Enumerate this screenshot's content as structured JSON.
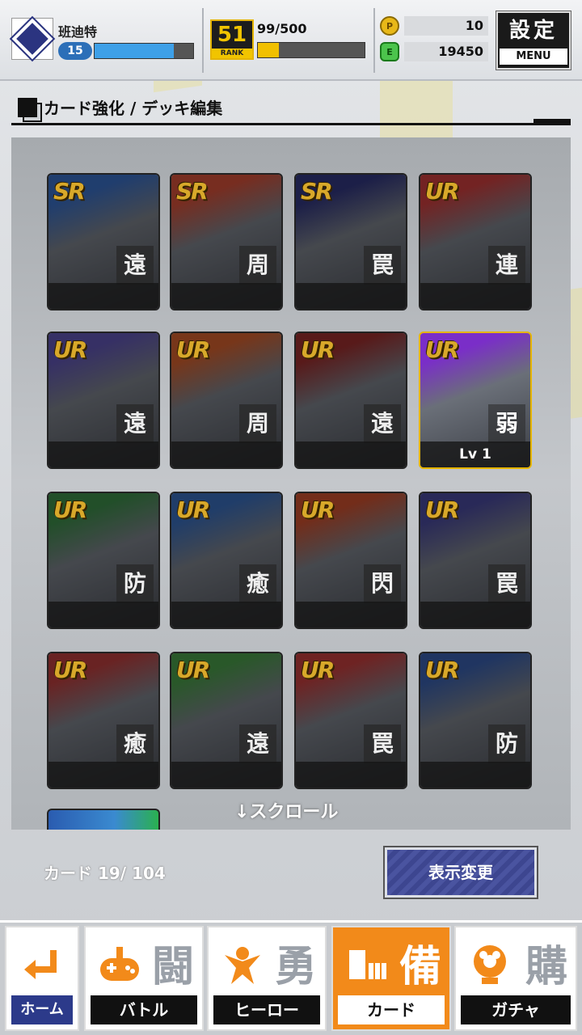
{
  "header": {
    "player_name": "班迪特",
    "level": "15",
    "level_progress": 0.8,
    "rank_number": "51",
    "rank_label": "RANK",
    "rank_exp": "99/500",
    "rank_progress": 0.2,
    "coin1_icon": "P",
    "coin1_value": "10",
    "coin2_icon": "E",
    "coin2_value": "19450",
    "menu_kanji": "設定",
    "menu_label": "MENU"
  },
  "section": {
    "title": "カード強化 / デッキ編集"
  },
  "cards": [
    {
      "rarity": "SR",
      "type": "遠",
      "bottom": "",
      "color": "#2a5db0"
    },
    {
      "rarity": "SR",
      "type": "周",
      "bottom": "",
      "color": "#c0402a"
    },
    {
      "rarity": "SR",
      "type": "罠",
      "bottom": "",
      "color": "#23286e"
    },
    {
      "rarity": "UR",
      "type": "連",
      "bottom": "",
      "color": "#b83030"
    },
    {
      "rarity": "UR",
      "type": "遠",
      "bottom": "",
      "color": "#5046a0"
    },
    {
      "rarity": "UR",
      "type": "周",
      "bottom": "",
      "color": "#c05020"
    },
    {
      "rarity": "UR",
      "type": "遠",
      "bottom": "",
      "color": "#8a2020"
    },
    {
      "rarity": "UR",
      "type": "弱",
      "bottom": "Lv 1",
      "color": "#7a2ec8",
      "selected": true
    },
    {
      "rarity": "UR",
      "type": "防",
      "bottom": "",
      "color": "#2d7a3a"
    },
    {
      "rarity": "UR",
      "type": "癒",
      "bottom": "",
      "color": "#2a5ca8"
    },
    {
      "rarity": "UR",
      "type": "閃",
      "bottom": "",
      "color": "#b84020"
    },
    {
      "rarity": "UR",
      "type": "罠",
      "bottom": "",
      "color": "#3a3a8a"
    },
    {
      "rarity": "UR",
      "type": "癒",
      "bottom": "",
      "color": "#a83030"
    },
    {
      "rarity": "UR",
      "type": "遠",
      "bottom": "",
      "color": "#3a8a3a"
    },
    {
      "rarity": "UR",
      "type": "罠",
      "bottom": "",
      "color": "#b03030"
    },
    {
      "rarity": "UR",
      "type": "防",
      "bottom": "",
      "color": "#2a4f9a"
    }
  ],
  "scroll_hint": "↓スクロール",
  "card_count": "カード 19/ 104",
  "display_change_button": "表示変更",
  "nav": [
    {
      "kanji": "",
      "label": "ホーム",
      "icon": "return-arrow-icon"
    },
    {
      "kanji": "闘",
      "label": "バトル",
      "icon": "gamepad-icon"
    },
    {
      "kanji": "勇",
      "label": "ヒーロー",
      "icon": "hero-icon"
    },
    {
      "kanji": "備",
      "label": "カード",
      "icon": "cards-icon",
      "active": true
    },
    {
      "kanji": "購",
      "label": "ガチャ",
      "icon": "gacha-icon"
    }
  ],
  "colors": {
    "accent_orange": "#f28a1a",
    "level_bar": "#3ea0e8",
    "rank_bar": "#f1c000",
    "button_blue": "#4a54a0"
  }
}
